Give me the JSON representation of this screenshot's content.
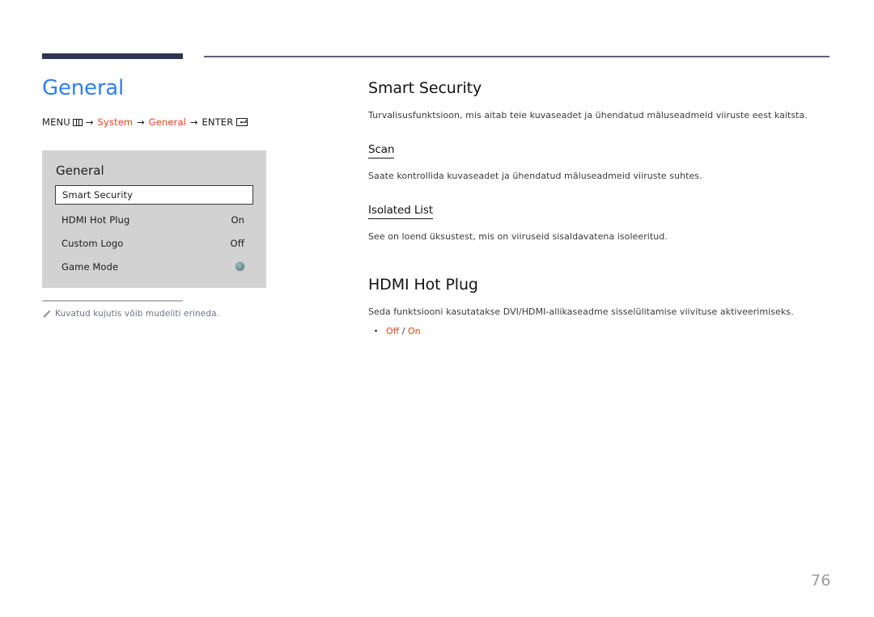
{
  "page": {
    "number": "76",
    "language": "et"
  },
  "left": {
    "title": "General",
    "breadcrumb": {
      "menu_label": "MENU",
      "menu_icon": "menu-grid-icon",
      "arrow": "→",
      "step1": "System",
      "step2": "General",
      "enter_label": "ENTER",
      "enter_icon": "enter-key-icon"
    },
    "osd": {
      "title": "General",
      "rows": [
        {
          "label": "Smart Security",
          "value": "",
          "selected": true,
          "control": "none"
        },
        {
          "label": "HDMI Hot Plug",
          "value": "On",
          "selected": false,
          "control": "text"
        },
        {
          "label": "Custom Logo",
          "value": "Off",
          "selected": false,
          "control": "text"
        },
        {
          "label": "Game Mode",
          "value": "",
          "selected": false,
          "control": "toggle-dot"
        }
      ]
    },
    "note": {
      "icon": "pencil-icon",
      "text": "Kuvatud kujutis võib mudeliti erineda."
    }
  },
  "right": {
    "sections": [
      {
        "heading": "Smart Security",
        "body": "Turvalisusfunktsioon, mis aitab teie kuvaseadet ja ühendatud mäluseadmeid viiruste eest kaitsta.",
        "subsections": [
          {
            "heading": "Scan",
            "body": "Saate kontrollida kuvaseadet ja ühendatud mäluseadmeid viiruste suhtes."
          },
          {
            "heading": "Isolated List",
            "body": "See on loend üksustest, mis on viiruseid sisaldavatena isoleeritud."
          }
        ]
      },
      {
        "heading": "HDMI Hot Plug",
        "body": "Seda funktsiooni kasutatakse DVI/HDMI-allikaseadme sisselülitamise viivituse aktiveerimiseks.",
        "options": {
          "first": "Off",
          "separator": "/",
          "second": "On"
        }
      }
    ]
  },
  "colors": {
    "accent_blue": "#2f7df4",
    "accent_orange": "#e8441f",
    "header_bar": "#2e3552",
    "osd_bg": "#d2d2d2",
    "page_number": "#9b9b9b"
  }
}
